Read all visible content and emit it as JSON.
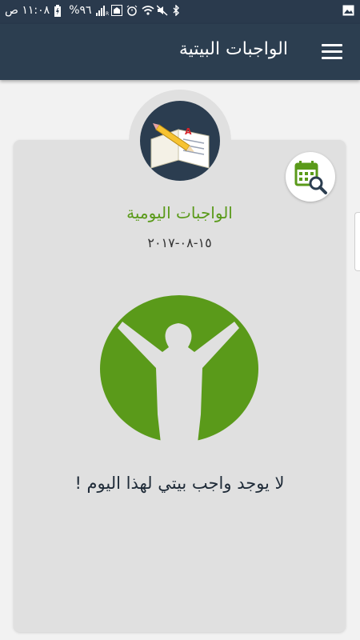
{
  "status_bar": {
    "time": "١١:٠٨ ص",
    "battery": "%٩٦"
  },
  "app_bar": {
    "title": "الواجبات البيتية",
    "icon": "menu-icon"
  },
  "card": {
    "title": "الواجبات اليومية",
    "date": "١٥-٠٨-٢٠١٧",
    "empty_message": "لا يوجد واجب بيتي لهذا اليوم !",
    "avatar_icon": "book-pencil-icon",
    "calendar_icon": "calendar-search-icon",
    "illustration": "celebrating-person-icon"
  },
  "colors": {
    "app_bar": "#2c3e50",
    "accent_green": "#5a9a1a",
    "card_bg": "#e0e0e0"
  }
}
